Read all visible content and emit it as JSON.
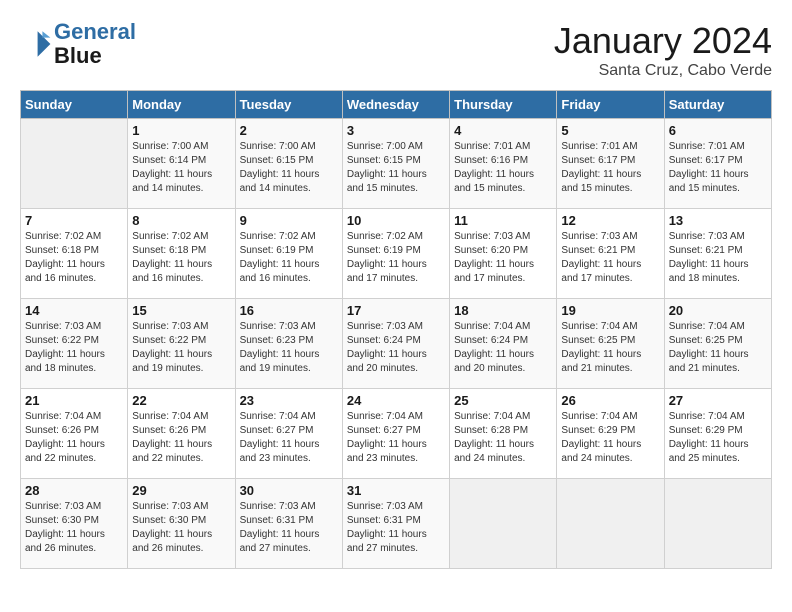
{
  "header": {
    "logo_line1": "General",
    "logo_line2": "Blue",
    "month": "January 2024",
    "location": "Santa Cruz, Cabo Verde"
  },
  "days_of_week": [
    "Sunday",
    "Monday",
    "Tuesday",
    "Wednesday",
    "Thursday",
    "Friday",
    "Saturday"
  ],
  "weeks": [
    [
      {
        "day": "",
        "sunrise": "",
        "sunset": "",
        "daylight": ""
      },
      {
        "day": "1",
        "sunrise": "Sunrise: 7:00 AM",
        "sunset": "Sunset: 6:14 PM",
        "daylight": "Daylight: 11 hours and 14 minutes."
      },
      {
        "day": "2",
        "sunrise": "Sunrise: 7:00 AM",
        "sunset": "Sunset: 6:15 PM",
        "daylight": "Daylight: 11 hours and 14 minutes."
      },
      {
        "day": "3",
        "sunrise": "Sunrise: 7:00 AM",
        "sunset": "Sunset: 6:15 PM",
        "daylight": "Daylight: 11 hours and 15 minutes."
      },
      {
        "day": "4",
        "sunrise": "Sunrise: 7:01 AM",
        "sunset": "Sunset: 6:16 PM",
        "daylight": "Daylight: 11 hours and 15 minutes."
      },
      {
        "day": "5",
        "sunrise": "Sunrise: 7:01 AM",
        "sunset": "Sunset: 6:17 PM",
        "daylight": "Daylight: 11 hours and 15 minutes."
      },
      {
        "day": "6",
        "sunrise": "Sunrise: 7:01 AM",
        "sunset": "Sunset: 6:17 PM",
        "daylight": "Daylight: 11 hours and 15 minutes."
      }
    ],
    [
      {
        "day": "7",
        "sunrise": "Sunrise: 7:02 AM",
        "sunset": "Sunset: 6:18 PM",
        "daylight": "Daylight: 11 hours and 16 minutes."
      },
      {
        "day": "8",
        "sunrise": "Sunrise: 7:02 AM",
        "sunset": "Sunset: 6:18 PM",
        "daylight": "Daylight: 11 hours and 16 minutes."
      },
      {
        "day": "9",
        "sunrise": "Sunrise: 7:02 AM",
        "sunset": "Sunset: 6:19 PM",
        "daylight": "Daylight: 11 hours and 16 minutes."
      },
      {
        "day": "10",
        "sunrise": "Sunrise: 7:02 AM",
        "sunset": "Sunset: 6:19 PM",
        "daylight": "Daylight: 11 hours and 17 minutes."
      },
      {
        "day": "11",
        "sunrise": "Sunrise: 7:03 AM",
        "sunset": "Sunset: 6:20 PM",
        "daylight": "Daylight: 11 hours and 17 minutes."
      },
      {
        "day": "12",
        "sunrise": "Sunrise: 7:03 AM",
        "sunset": "Sunset: 6:21 PM",
        "daylight": "Daylight: 11 hours and 17 minutes."
      },
      {
        "day": "13",
        "sunrise": "Sunrise: 7:03 AM",
        "sunset": "Sunset: 6:21 PM",
        "daylight": "Daylight: 11 hours and 18 minutes."
      }
    ],
    [
      {
        "day": "14",
        "sunrise": "Sunrise: 7:03 AM",
        "sunset": "Sunset: 6:22 PM",
        "daylight": "Daylight: 11 hours and 18 minutes."
      },
      {
        "day": "15",
        "sunrise": "Sunrise: 7:03 AM",
        "sunset": "Sunset: 6:22 PM",
        "daylight": "Daylight: 11 hours and 19 minutes."
      },
      {
        "day": "16",
        "sunrise": "Sunrise: 7:03 AM",
        "sunset": "Sunset: 6:23 PM",
        "daylight": "Daylight: 11 hours and 19 minutes."
      },
      {
        "day": "17",
        "sunrise": "Sunrise: 7:03 AM",
        "sunset": "Sunset: 6:24 PM",
        "daylight": "Daylight: 11 hours and 20 minutes."
      },
      {
        "day": "18",
        "sunrise": "Sunrise: 7:04 AM",
        "sunset": "Sunset: 6:24 PM",
        "daylight": "Daylight: 11 hours and 20 minutes."
      },
      {
        "day": "19",
        "sunrise": "Sunrise: 7:04 AM",
        "sunset": "Sunset: 6:25 PM",
        "daylight": "Daylight: 11 hours and 21 minutes."
      },
      {
        "day": "20",
        "sunrise": "Sunrise: 7:04 AM",
        "sunset": "Sunset: 6:25 PM",
        "daylight": "Daylight: 11 hours and 21 minutes."
      }
    ],
    [
      {
        "day": "21",
        "sunrise": "Sunrise: 7:04 AM",
        "sunset": "Sunset: 6:26 PM",
        "daylight": "Daylight: 11 hours and 22 minutes."
      },
      {
        "day": "22",
        "sunrise": "Sunrise: 7:04 AM",
        "sunset": "Sunset: 6:26 PM",
        "daylight": "Daylight: 11 hours and 22 minutes."
      },
      {
        "day": "23",
        "sunrise": "Sunrise: 7:04 AM",
        "sunset": "Sunset: 6:27 PM",
        "daylight": "Daylight: 11 hours and 23 minutes."
      },
      {
        "day": "24",
        "sunrise": "Sunrise: 7:04 AM",
        "sunset": "Sunset: 6:27 PM",
        "daylight": "Daylight: 11 hours and 23 minutes."
      },
      {
        "day": "25",
        "sunrise": "Sunrise: 7:04 AM",
        "sunset": "Sunset: 6:28 PM",
        "daylight": "Daylight: 11 hours and 24 minutes."
      },
      {
        "day": "26",
        "sunrise": "Sunrise: 7:04 AM",
        "sunset": "Sunset: 6:29 PM",
        "daylight": "Daylight: 11 hours and 24 minutes."
      },
      {
        "day": "27",
        "sunrise": "Sunrise: 7:04 AM",
        "sunset": "Sunset: 6:29 PM",
        "daylight": "Daylight: 11 hours and 25 minutes."
      }
    ],
    [
      {
        "day": "28",
        "sunrise": "Sunrise: 7:03 AM",
        "sunset": "Sunset: 6:30 PM",
        "daylight": "Daylight: 11 hours and 26 minutes."
      },
      {
        "day": "29",
        "sunrise": "Sunrise: 7:03 AM",
        "sunset": "Sunset: 6:30 PM",
        "daylight": "Daylight: 11 hours and 26 minutes."
      },
      {
        "day": "30",
        "sunrise": "Sunrise: 7:03 AM",
        "sunset": "Sunset: 6:31 PM",
        "daylight": "Daylight: 11 hours and 27 minutes."
      },
      {
        "day": "31",
        "sunrise": "Sunrise: 7:03 AM",
        "sunset": "Sunset: 6:31 PM",
        "daylight": "Daylight: 11 hours and 27 minutes."
      },
      {
        "day": "",
        "sunrise": "",
        "sunset": "",
        "daylight": ""
      },
      {
        "day": "",
        "sunrise": "",
        "sunset": "",
        "daylight": ""
      },
      {
        "day": "",
        "sunrise": "",
        "sunset": "",
        "daylight": ""
      }
    ]
  ]
}
